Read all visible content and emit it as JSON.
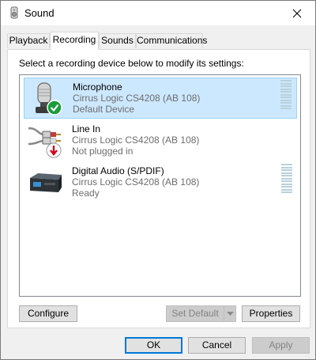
{
  "window": {
    "title": "Sound",
    "close_symbol": "✕"
  },
  "tabs": [
    {
      "label": "Playback",
      "active": false
    },
    {
      "label": "Recording",
      "active": true
    },
    {
      "label": "Sounds",
      "active": false
    },
    {
      "label": "Communications",
      "active": false
    }
  ],
  "recording": {
    "instruction": "Select a recording device below to modify its settings:",
    "devices": [
      {
        "name": "Microphone",
        "driver": "Cirrus Logic CS4208 (AB 108)",
        "status": "Default Device",
        "icon": "microphone-icon",
        "badge": "default-check-icon",
        "selected": true
      },
      {
        "name": "Line In",
        "driver": "Cirrus Logic CS4208 (AB 108)",
        "status": "Not plugged in",
        "icon": "line-in-cable-icon",
        "badge": "unplugged-arrow-icon",
        "selected": false
      },
      {
        "name": "Digital Audio (S/PDIF)",
        "driver": "Cirrus Logic CS4208 (AB 108)",
        "status": "Ready",
        "icon": "digital-audio-box-icon",
        "badge": "",
        "selected": false
      }
    ]
  },
  "buttons": {
    "configure": "Configure",
    "set_default": "Set Default",
    "properties": "Properties",
    "ok": "OK",
    "cancel": "Cancel",
    "apply": "Apply"
  },
  "colors": {
    "selection": "#cce8ff",
    "selection_border": "#99d1ff",
    "accent": "#0078d7",
    "check_green": "#1a9c3c",
    "unplug_red": "#d0021b"
  }
}
